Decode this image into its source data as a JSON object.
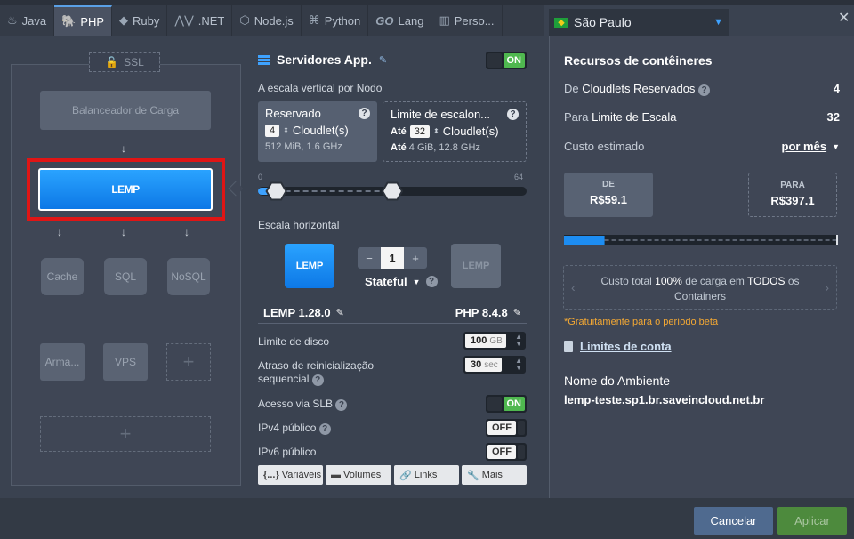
{
  "tabs": [
    {
      "label": "Java",
      "icon": "java-icon"
    },
    {
      "label": "PHP",
      "icon": "php-icon"
    },
    {
      "label": "Ruby",
      "icon": "ruby-icon"
    },
    {
      "label": ".NET",
      "icon": "dotnet-icon"
    },
    {
      "label": "Node.js",
      "icon": "nodejs-icon"
    },
    {
      "label": "Python",
      "icon": "python-icon"
    },
    {
      "label": "Lang",
      "icon": "go-icon"
    },
    {
      "label": "Perso...",
      "icon": "custom-icon"
    }
  ],
  "region": {
    "name": "São Paulo"
  },
  "topology": {
    "ssl_label": "SSL",
    "balancer_label": "Balanceador de Carga",
    "node_label": "LEMP",
    "databases": [
      "Cache",
      "SQL",
      "NoSQL"
    ],
    "storage_label": "Arma...",
    "vps_label": "VPS"
  },
  "config": {
    "title": "Servidores App.",
    "toggle_on": "ON",
    "toggle_off": "OFF",
    "vertical_label": "A escala vertical por Nodo",
    "reserved": {
      "title": "Reservado",
      "count": "4",
      "unit": "Cloudlet(s)",
      "sub": "512 MiB, 1.6 GHz"
    },
    "limit": {
      "title": "Limite de escalon...",
      "prefix": "Até",
      "count": "32",
      "unit": "Cloudlet(s)",
      "sub_prefix": "Até",
      "sub": "4 GiB, 12.8 GHz"
    },
    "slider": {
      "min": "0",
      "max": "64",
      "reserved": 4,
      "limit": 32
    },
    "horizontal_label": "Escala horizontal",
    "node_count": "1",
    "stateful_label": "Stateful",
    "stack_name": "LEMP",
    "stack_version": "LEMP 1.28.0",
    "php_version": "PHP 8.4.8",
    "disk_label": "Limite de disco",
    "disk_value": "100",
    "disk_unit": "GB",
    "restart_label": "Atraso de reinicialização sequencial",
    "restart_value": "30",
    "restart_unit": "sec",
    "slb_label": "Acesso via SLB",
    "ipv4_label": "IPv4 público",
    "ipv6_label": "IPv6 público",
    "buttons": [
      {
        "label": "Variáveis",
        "glyph": "{...}"
      },
      {
        "label": "Volumes",
        "glyph": "▬"
      },
      {
        "label": "Links",
        "glyph": "🔗"
      },
      {
        "label": "Mais",
        "glyph": "🔧"
      }
    ]
  },
  "resources": {
    "title": "Recursos de contêineres",
    "reserved_prefix": "De",
    "reserved_label": "Cloudlets Reservados",
    "reserved_value": "4",
    "limit_prefix": "Para",
    "limit_label": "Limite de Escala",
    "limit_value": "32",
    "cost_label": "Custo estimado",
    "period": "por mês",
    "from_caption": "DE",
    "from_value": "R$59.1",
    "to_caption": "PARA",
    "to_value": "R$397.1",
    "cost_fill": 0.148,
    "total_text_1": "Custo total",
    "total_pct": "100%",
    "total_text_2": "de carga em",
    "total_text_3": "TODOS",
    "total_text_4": "os Containers",
    "free_note": "*Gratuitamente para o período beta",
    "limits_link": "Limites de conta",
    "env_label": "Nome do Ambiente",
    "env_value": "lemp-teste.sp1.br.saveincloud.net.br"
  },
  "footer": {
    "cancel": "Cancelar",
    "apply": "Aplicar"
  },
  "colors": {
    "accent": "#0d8bff",
    "on": "#4fb84f",
    "highlight": "#e01515",
    "apply": "#4d8a3d"
  }
}
